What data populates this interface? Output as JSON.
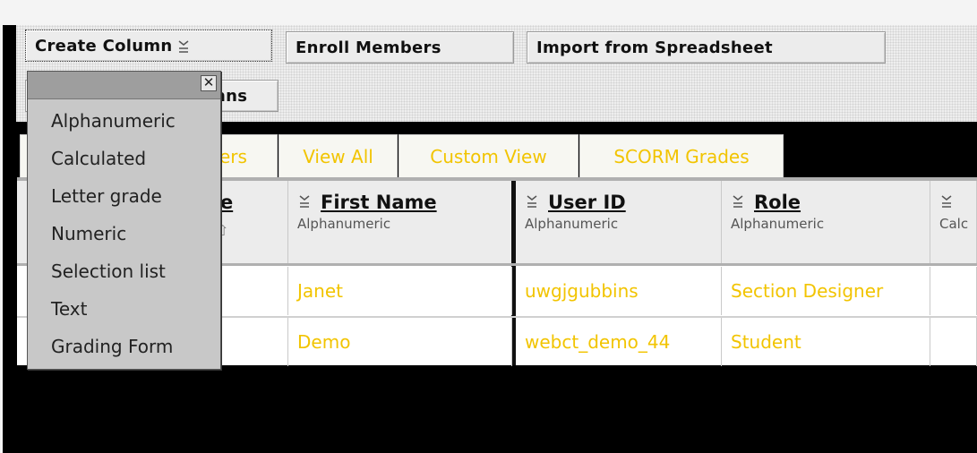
{
  "toolbar": {
    "create_column_label": "Create Column",
    "enroll_members_label": "Enroll Members",
    "import_label": "Import from Spreadsheet",
    "columns_label_visible": "nns"
  },
  "tabs": [
    {
      "label": "ers"
    },
    {
      "label": "View All"
    },
    {
      "label": "Custom View"
    },
    {
      "label": "SCORM Grades"
    }
  ],
  "table": {
    "columns": [
      {
        "title": "ne",
        "type": ""
      },
      {
        "title": "First Name",
        "type": "Alphanumeric"
      },
      {
        "title": "User ID",
        "type": "Alphanumeric"
      },
      {
        "title": "Role",
        "type": "Alphanumeric"
      },
      {
        "title": "",
        "type": "Calc"
      }
    ],
    "rows": [
      {
        "first_name": "Janet",
        "user_id": "uwgjgubbins",
        "role": "Section Designer"
      },
      {
        "first_name": "Demo",
        "user_id": "webct_demo_44",
        "role": "Student"
      }
    ]
  },
  "dropdown": {
    "items": [
      "Alphanumeric",
      "Calculated",
      "Letter grade",
      "Numeric",
      "Selection list",
      "Text",
      "Grading Form"
    ]
  },
  "colors": {
    "link_text": "#f2c400",
    "header_bg": "#ececec",
    "menu_bg": "#c8c8c8"
  }
}
